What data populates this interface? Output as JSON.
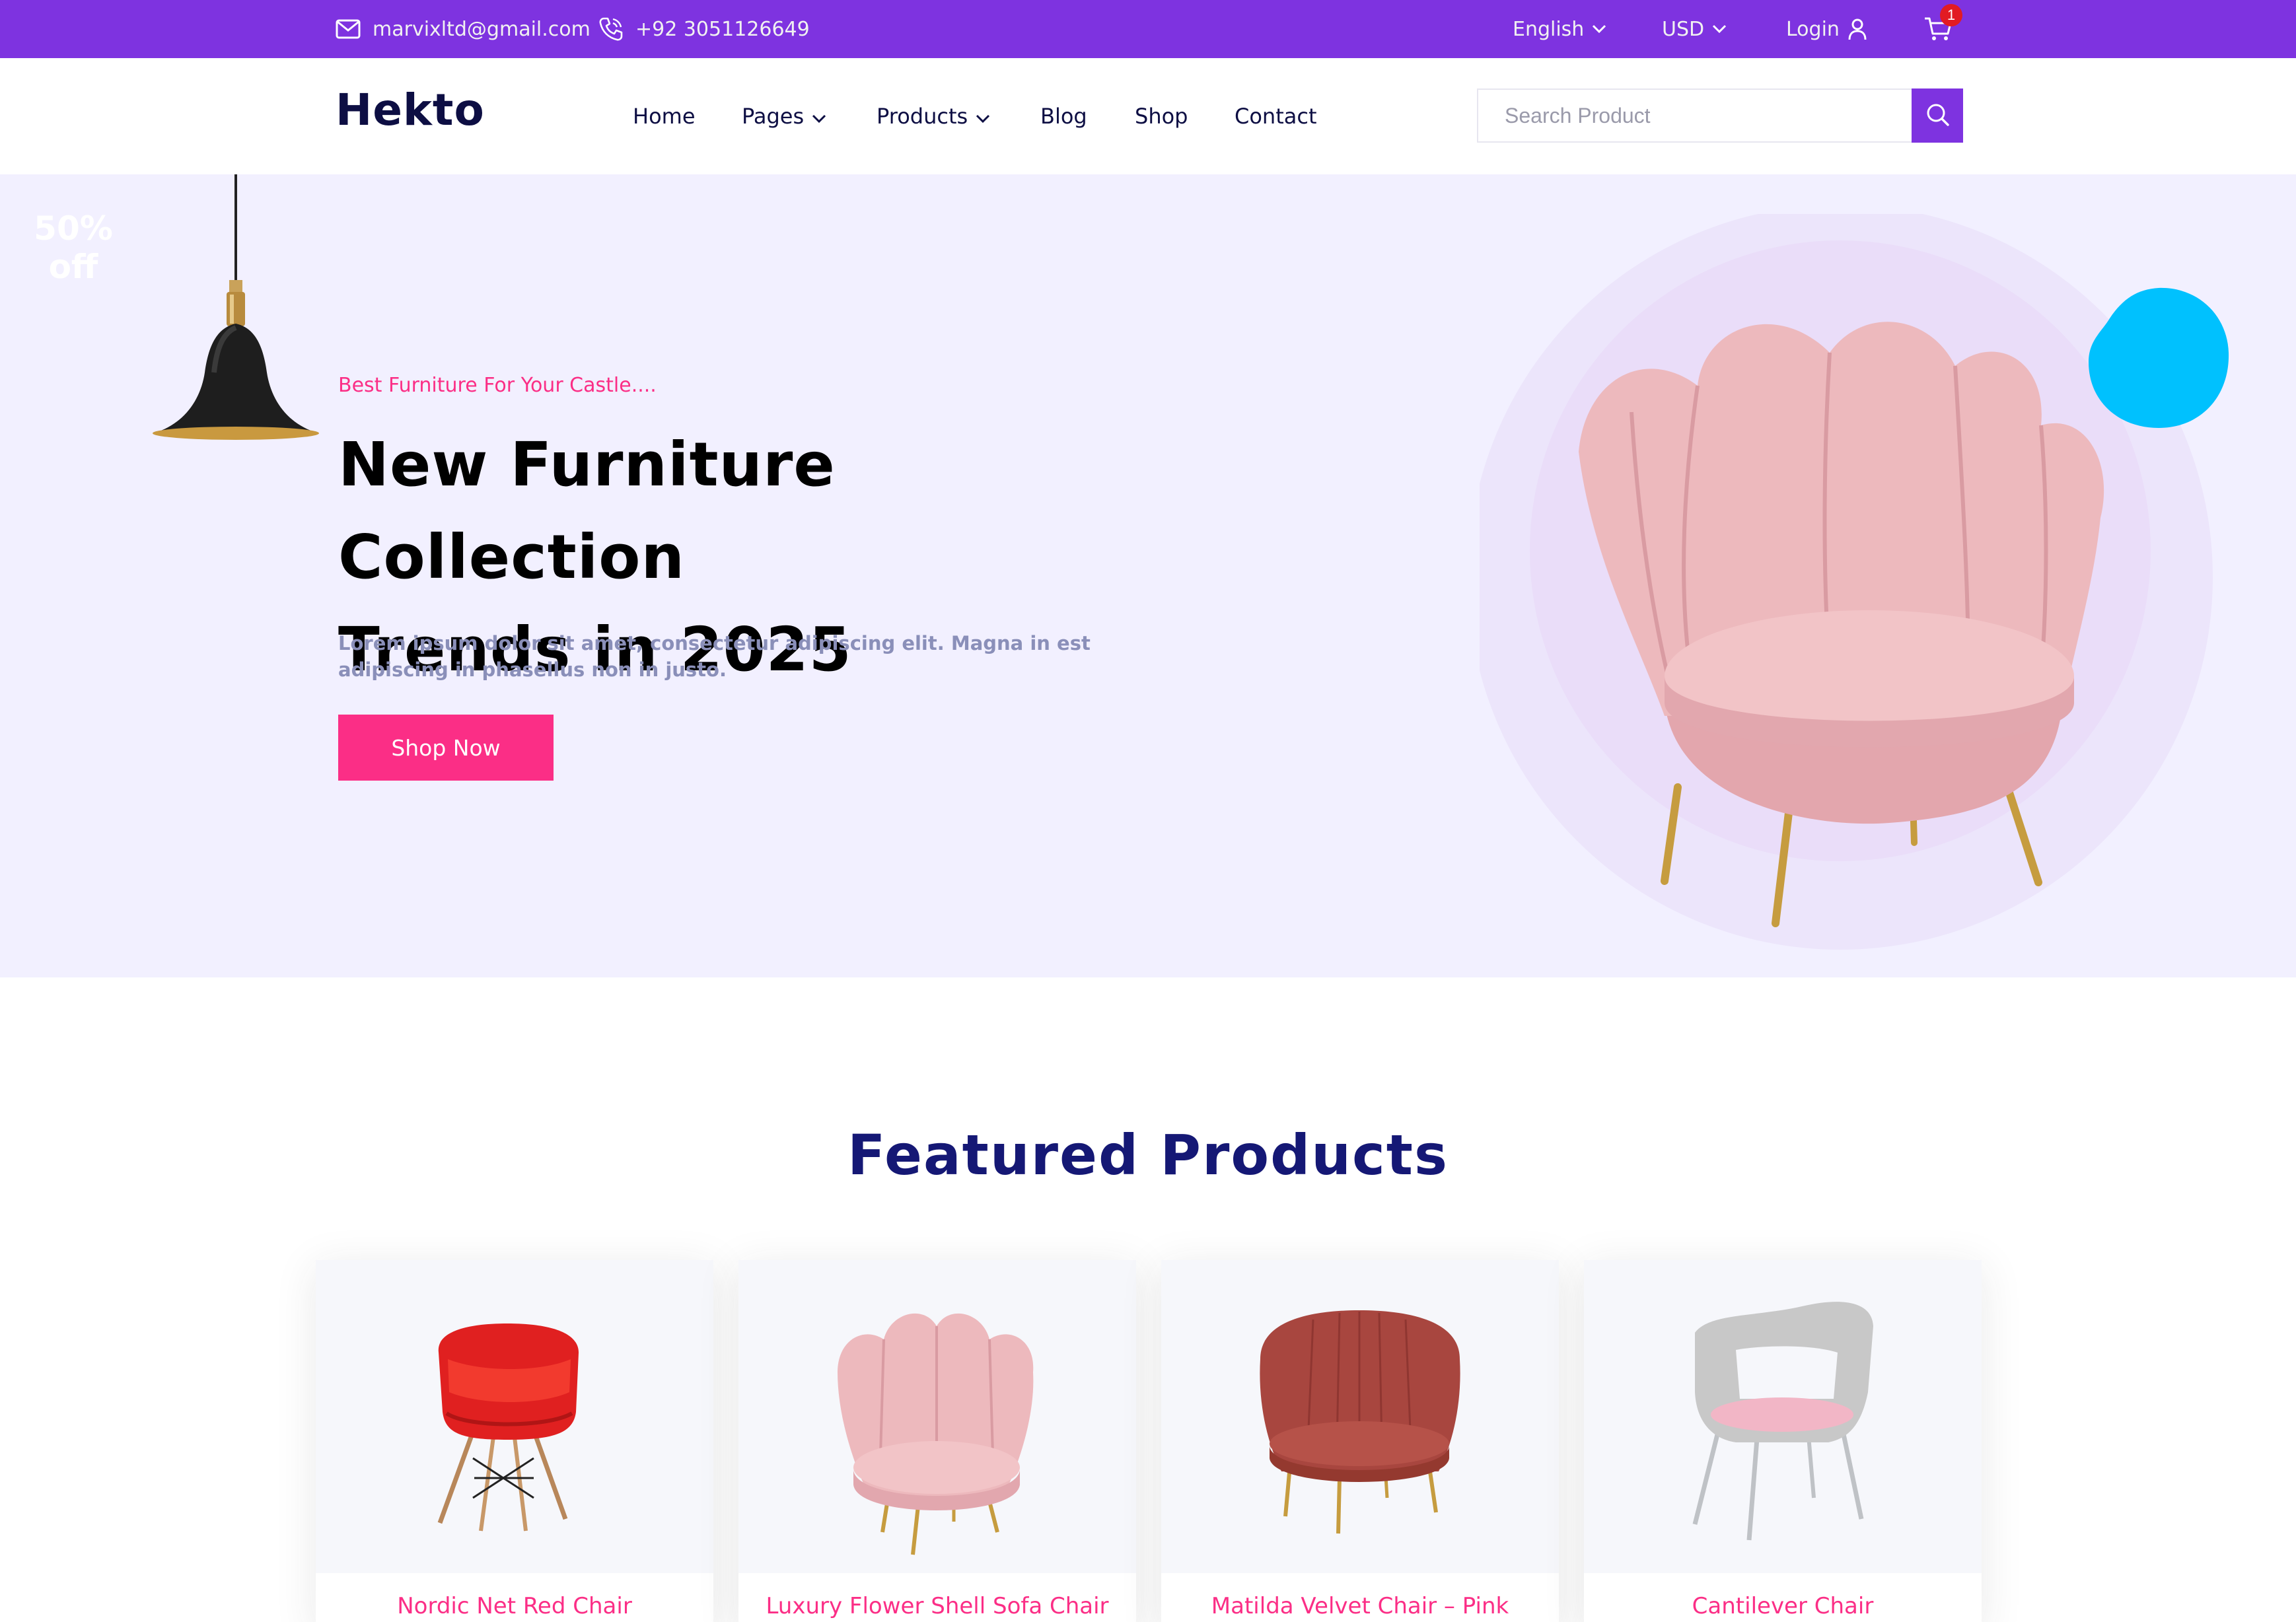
{
  "topbar": {
    "email": "marvixltd@gmail.com",
    "phone": "+92 3051126649",
    "language": "English",
    "currency": "USD",
    "login": "Login",
    "cart_count": "1"
  },
  "header": {
    "logo": "Hekto",
    "nav": [
      {
        "label": "Home"
      },
      {
        "label": "Pages"
      },
      {
        "label": "Products"
      },
      {
        "label": "Blog"
      },
      {
        "label": "Shop"
      },
      {
        "label": "Contact"
      }
    ],
    "search": {
      "placeholder": "Search Product",
      "value": ""
    }
  },
  "hero": {
    "subtitle": "Best Furniture For Your Castle....",
    "headline_line1": "New Furniture Collection",
    "headline_line2": "Trends in 2025",
    "lead": "Lorem ipsum dolor sit amet, consectetur adipiscing elit. Magna in est adipiscing in phasellus non in justo.",
    "cta": "Shop Now",
    "badge_line1": "50%",
    "badge_line2": "off"
  },
  "featured": {
    "title": "Featured Products",
    "products": [
      {
        "name": "Nordic Net Red Chair"
      },
      {
        "name": "Luxury Flower Shell Sofa Chair"
      },
      {
        "name": "Matilda Velvet Chair – Pink"
      },
      {
        "name": "Cantilever Chair"
      }
    ]
  },
  "colors": {
    "accent_purple": "#7e33e0",
    "accent_pink": "#fb2e86",
    "navy": "#151875",
    "hero_bg": "#f2f0ff",
    "badge": "#00c1fe"
  },
  "icons": [
    "mail-icon",
    "phone-icon",
    "chevron-down-icon",
    "user-icon",
    "cart-icon",
    "search-icon"
  ]
}
